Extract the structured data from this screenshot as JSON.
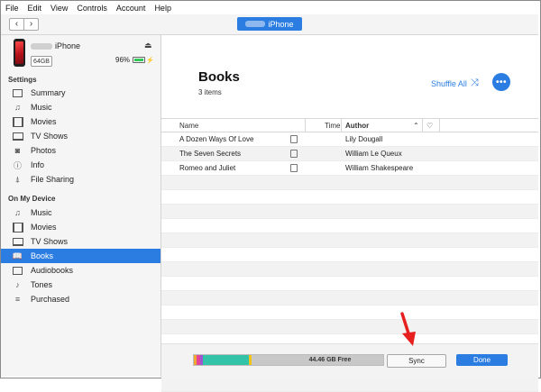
{
  "menubar": {
    "items": [
      "File",
      "Edit",
      "View",
      "Controls",
      "Account",
      "Help"
    ]
  },
  "toolbar": {
    "back": "‹",
    "forward": "›",
    "device_label": "iPhone"
  },
  "device": {
    "name": "iPhone",
    "capacity": "64GB",
    "battery_text": "96%",
    "battery_level": 0.96,
    "eject": "⏏"
  },
  "sidebar": {
    "settings_header": "Settings",
    "settings": [
      {
        "label": "Summary",
        "icon": "summary-icon"
      },
      {
        "label": "Music",
        "icon": "music-note-icon"
      },
      {
        "label": "Movies",
        "icon": "film-icon"
      },
      {
        "label": "TV Shows",
        "icon": "tv-icon"
      },
      {
        "label": "Photos",
        "icon": "camera-icon"
      },
      {
        "label": "Info",
        "icon": "info-icon"
      },
      {
        "label": "File Sharing",
        "icon": "apps-icon"
      }
    ],
    "device_header": "On My Device",
    "on_device": [
      {
        "label": "Music",
        "icon": "music-note-icon"
      },
      {
        "label": "Movies",
        "icon": "film-icon"
      },
      {
        "label": "TV Shows",
        "icon": "tv-icon"
      },
      {
        "label": "Books",
        "icon": "book-icon",
        "selected": true
      },
      {
        "label": "Audiobooks",
        "icon": "audiobook-icon"
      },
      {
        "label": "Tones",
        "icon": "bell-icon"
      },
      {
        "label": "Purchased",
        "icon": "list-icon"
      }
    ]
  },
  "main": {
    "title": "Books",
    "subtitle": "3 items",
    "shuffle_label": "Shuffle All",
    "more": "•••",
    "columns": {
      "name": "Name",
      "time": "Time",
      "author": "Author",
      "sort": "⌃",
      "heart": "♡"
    },
    "rows": [
      {
        "name": "A Dozen Ways Of Love",
        "author": "Lily Dougall"
      },
      {
        "name": "The Seven Secrets",
        "author": "William Le Queux"
      },
      {
        "name": "Romeo and Juliet",
        "author": "William Shakespeare"
      }
    ]
  },
  "bottom": {
    "free_label": "44.46 GB Free",
    "sync_label": "Sync",
    "done_label": "Done",
    "storage_segments": [
      {
        "color": "#f0a634",
        "fraction": 0.015
      },
      {
        "color": "#e2449a",
        "fraction": 0.02
      },
      {
        "color": "#9b59d0",
        "fraction": 0.015
      },
      {
        "color": "#33c3a8",
        "fraction": 0.24
      },
      {
        "color": "#f0c419",
        "fraction": 0.015
      },
      {
        "color": "#c8c8c8",
        "fraction": 0.695
      }
    ]
  },
  "colors": {
    "accent": "#2b7de1",
    "arrow": "#e5201f"
  }
}
